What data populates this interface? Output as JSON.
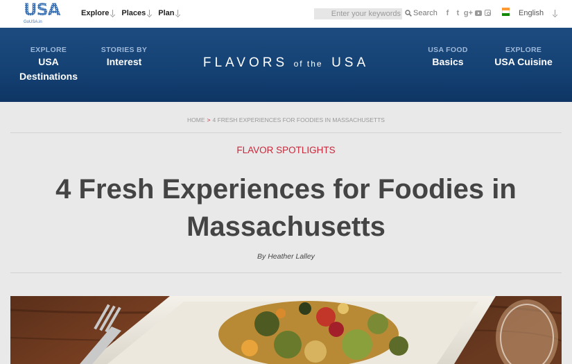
{
  "logo": {
    "wordmark": "USA",
    "subtext": "GoUSA.in"
  },
  "top_nav": {
    "items": [
      {
        "label": "Explore"
      },
      {
        "label": "Places"
      },
      {
        "label": "Plan"
      }
    ]
  },
  "search": {
    "placeholder": "Enter your keywords",
    "button_label": "Search"
  },
  "social": {
    "facebook": "f",
    "twitter": "t",
    "google_plus": "g+"
  },
  "language": {
    "selected": "English",
    "flag_colors": [
      "#ff9933",
      "#ffffff",
      "#138808"
    ]
  },
  "banner": {
    "left": [
      {
        "small": "EXPLORE",
        "big_lines": [
          "USA",
          "Destinations"
        ]
      },
      {
        "small": "STORIES BY",
        "big_lines": [
          "Interest"
        ]
      }
    ],
    "title": {
      "part1": "FLAVORS",
      "part2": "of the",
      "part3": "USA"
    },
    "right": [
      {
        "small": "USA FOOD",
        "big_lines": [
          "Basics"
        ]
      },
      {
        "small": "EXPLORE",
        "big_lines": [
          "USA Cuisine"
        ]
      }
    ]
  },
  "breadcrumb": {
    "home": "HOME",
    "separator": ">",
    "current": "4 FRESH EXPERIENCES FOR FOODIES IN MASSACHUSETTS"
  },
  "article": {
    "category": "FLAVOR SPOTLIGHTS",
    "title": "4 Fresh Experiences for Foodies in Massachusetts",
    "byline": "By Heather Lalley"
  },
  "colors": {
    "accent": "#c6283a",
    "banner": "#154274",
    "brand": "#3d73b7"
  }
}
